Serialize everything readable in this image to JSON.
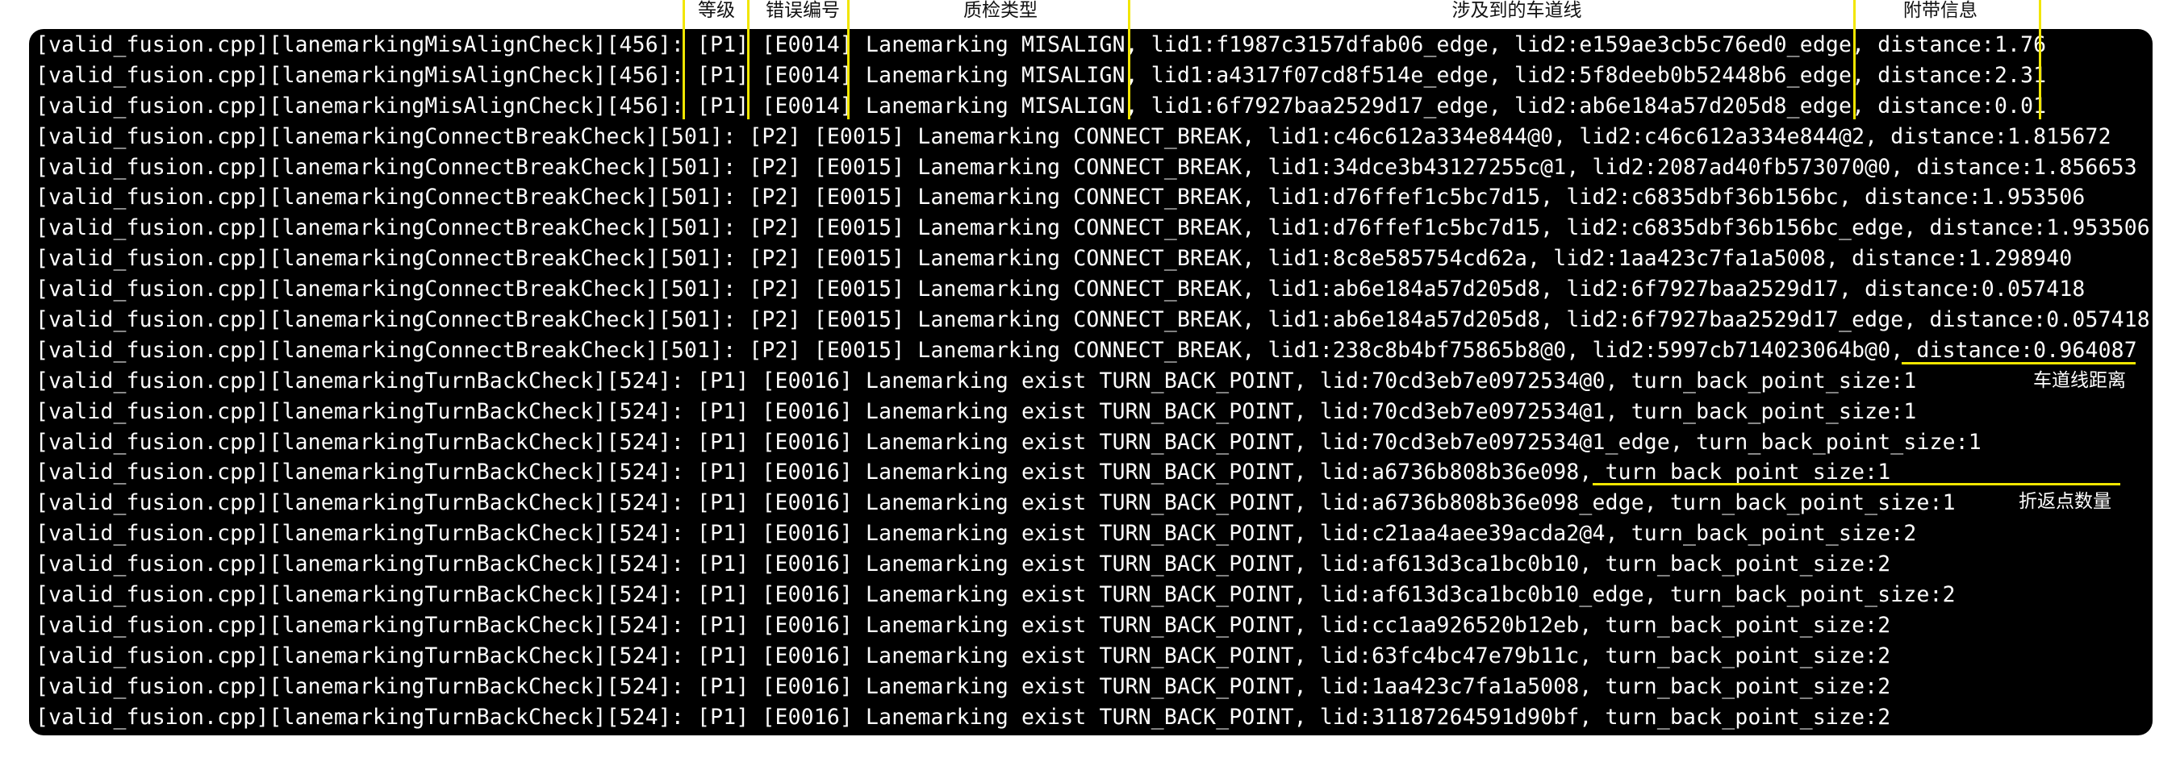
{
  "column_labels": {
    "level": "等级",
    "error_code": "错误编号",
    "check_type": "质检类型",
    "lanes_involved": "涉及到的车道线",
    "extra_info": "附带信息"
  },
  "side_notes": {
    "lane_distance": "车道线距离",
    "turn_back_count": "折返点数量"
  },
  "annotation_color": "#f2e600",
  "log_lines": [
    "[valid_fusion.cpp][lanemarkingMisAlignCheck][456]: [P1] [E0014] Lanemarking MISALIGN, lid1:f1987c3157dfab06_edge, lid2:e159ae3cb5c76ed0_edge, distance:1.76",
    "[valid_fusion.cpp][lanemarkingMisAlignCheck][456]: [P1] [E0014] Lanemarking MISALIGN, lid1:a4317f07cd8f514e_edge, lid2:5f8deeb0b52448b6_edge, distance:2.31",
    "[valid_fusion.cpp][lanemarkingMisAlignCheck][456]: [P1] [E0014] Lanemarking MISALIGN, lid1:6f7927baa2529d17_edge, lid2:ab6e184a57d205d8_edge, distance:0.01",
    "[valid_fusion.cpp][lanemarkingConnectBreakCheck][501]: [P2] [E0015] Lanemarking CONNECT_BREAK, lid1:c46c612a334e844@0, lid2:c46c612a334e844@2, distance:1.815672",
    "[valid_fusion.cpp][lanemarkingConnectBreakCheck][501]: [P2] [E0015] Lanemarking CONNECT_BREAK, lid1:34dce3b43127255c@1, lid2:2087ad40fb573070@0, distance:1.856653",
    "[valid_fusion.cpp][lanemarkingConnectBreakCheck][501]: [P2] [E0015] Lanemarking CONNECT_BREAK, lid1:d76ffef1c5bc7d15, lid2:c6835dbf36b156bc, distance:1.953506",
    "[valid_fusion.cpp][lanemarkingConnectBreakCheck][501]: [P2] [E0015] Lanemarking CONNECT_BREAK, lid1:d76ffef1c5bc7d15, lid2:c6835dbf36b156bc_edge, distance:1.953506",
    "[valid_fusion.cpp][lanemarkingConnectBreakCheck][501]: [P2] [E0015] Lanemarking CONNECT_BREAK, lid1:8c8e585754cd62a, lid2:1aa423c7fa1a5008, distance:1.298940",
    "[valid_fusion.cpp][lanemarkingConnectBreakCheck][501]: [P2] [E0015] Lanemarking CONNECT_BREAK, lid1:ab6e184a57d205d8, lid2:6f7927baa2529d17, distance:0.057418",
    "[valid_fusion.cpp][lanemarkingConnectBreakCheck][501]: [P2] [E0015] Lanemarking CONNECT_BREAK, lid1:ab6e184a57d205d8, lid2:6f7927baa2529d17_edge, distance:0.057418",
    "[valid_fusion.cpp][lanemarkingConnectBreakCheck][501]: [P2] [E0015] Lanemarking CONNECT_BREAK, lid1:238c8b4bf75865b8@0, lid2:5997cb714023064b@0, distance:0.964087",
    "[valid_fusion.cpp][lanemarkingTurnBackCheck][524]: [P1] [E0016] Lanemarking exist TURN_BACK_POINT, lid:70cd3eb7e0972534@0, turn_back_point_size:1",
    "[valid_fusion.cpp][lanemarkingTurnBackCheck][524]: [P1] [E0016] Lanemarking exist TURN_BACK_POINT, lid:70cd3eb7e0972534@1, turn_back_point_size:1",
    "[valid_fusion.cpp][lanemarkingTurnBackCheck][524]: [P1] [E0016] Lanemarking exist TURN_BACK_POINT, lid:70cd3eb7e0972534@1_edge, turn_back_point_size:1",
    "[valid_fusion.cpp][lanemarkingTurnBackCheck][524]: [P1] [E0016] Lanemarking exist TURN_BACK_POINT, lid:a6736b808b36e098, turn_back_point_size:1",
    "[valid_fusion.cpp][lanemarkingTurnBackCheck][524]: [P1] [E0016] Lanemarking exist TURN_BACK_POINT, lid:a6736b808b36e098_edge, turn_back_point_size:1",
    "[valid_fusion.cpp][lanemarkingTurnBackCheck][524]: [P1] [E0016] Lanemarking exist TURN_BACK_POINT, lid:c21aa4aee39acda2@4, turn_back_point_size:2",
    "[valid_fusion.cpp][lanemarkingTurnBackCheck][524]: [P1] [E0016] Lanemarking exist TURN_BACK_POINT, lid:af613d3ca1bc0b10, turn_back_point_size:2",
    "[valid_fusion.cpp][lanemarkingTurnBackCheck][524]: [P1] [E0016] Lanemarking exist TURN_BACK_POINT, lid:af613d3ca1bc0b10_edge, turn_back_point_size:2",
    "[valid_fusion.cpp][lanemarkingTurnBackCheck][524]: [P1] [E0016] Lanemarking exist TURN_BACK_POINT, lid:cc1aa926520b12eb, turn_back_point_size:2",
    "[valid_fusion.cpp][lanemarkingTurnBackCheck][524]: [P1] [E0016] Lanemarking exist TURN_BACK_POINT, lid:63fc4bc47e79b11c, turn_back_point_size:2",
    "[valid_fusion.cpp][lanemarkingTurnBackCheck][524]: [P1] [E0016] Lanemarking exist TURN_BACK_POINT, lid:1aa423c7fa1a5008, turn_back_point_size:2",
    "[valid_fusion.cpp][lanemarkingTurnBackCheck][524]: [P1] [E0016] Lanemarking exist TURN_BACK_POINT, lid:31187264591d90bf, turn_back_point_size:2"
  ]
}
